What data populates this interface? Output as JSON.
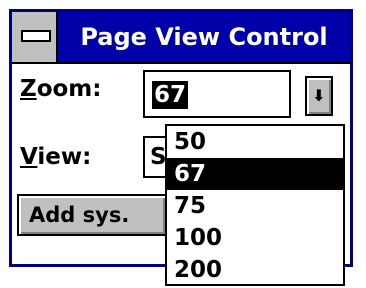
{
  "window": {
    "title": "Page View Control",
    "system_menu_icon": "system-menu-bar-icon"
  },
  "zoom": {
    "label_mnemonic": "Z",
    "label_rest": "oom:",
    "value": "67",
    "dropdown_icon": "down-arrow-icon",
    "options": [
      "50",
      "67",
      "75",
      "100",
      "200"
    ],
    "selected_index": 1
  },
  "view": {
    "label_mnemonic": "V",
    "label_rest": "iew:",
    "value_partial": "S"
  },
  "buttons": {
    "add_sys_label": "Add sys."
  },
  "colors": {
    "title_bar": "#0000a8",
    "frame": "#000080",
    "button_face": "#c0c0c0",
    "highlight": "#000000"
  }
}
